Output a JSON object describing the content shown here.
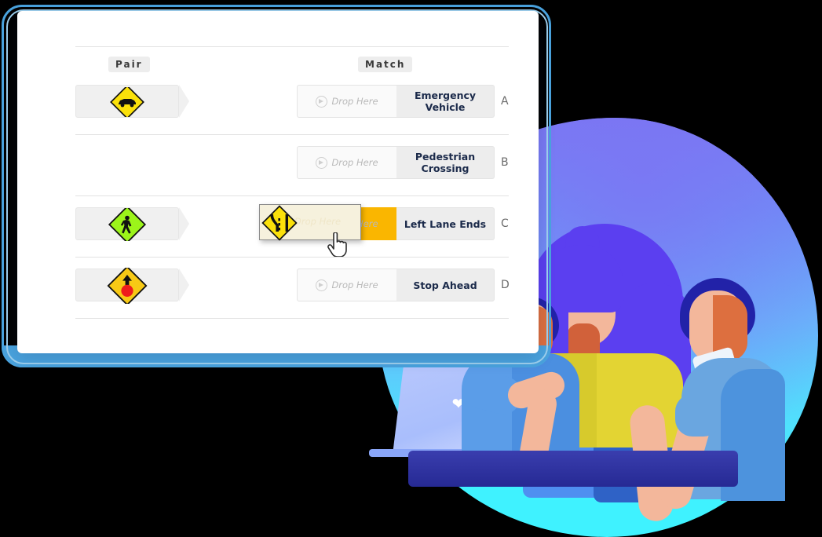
{
  "window": {
    "frame_color": "#4aa3de",
    "background": "#ffffff"
  },
  "quiz": {
    "column_headers": {
      "pair": "Pair",
      "match": "Match"
    },
    "drop_placeholder": "Drop Here",
    "drop_icon": "circle-arrow-right-icon",
    "rows": [
      {
        "letter": "A",
        "answer": "Emergency Vehicle",
        "pair_sign": "emergency-vehicle-sign",
        "pair_sign_alt": "yellow diamond with black vehicle",
        "has_pair": true,
        "drop_state": "empty"
      },
      {
        "letter": "B",
        "answer": "Pedestrian Crossing",
        "pair_sign": null,
        "pair_sign_alt": "",
        "has_pair": false,
        "drop_state": "empty"
      },
      {
        "letter": "C",
        "answer": "Left Lane Ends",
        "pair_sign": "pedestrian-crossing-sign",
        "pair_sign_alt": "green diamond with walking person",
        "has_pair": true,
        "drop_state": "highlighted"
      },
      {
        "letter": "D",
        "answer": "Stop Ahead",
        "pair_sign": "stop-ahead-sign",
        "pair_sign_alt": "yellow diamond with red octagon and arrow",
        "has_pair": true,
        "drop_state": "empty"
      }
    ],
    "dragging": {
      "sign": "left-lane-ends-sign",
      "sign_alt": "yellow diamond with merging lane lines",
      "label": "Drop Here",
      "target_row_letter": "C",
      "cursor": "pointing-hand-cursor"
    }
  },
  "illustration": {
    "name": "three-people-at-laptop-illustration",
    "blob_gradient_top": "#7b76f3",
    "blob_gradient_bottom": "#3ff2ff",
    "laptop_logo": "heart-icon",
    "desk_color": "#2b2fa8",
    "people": [
      {
        "name": "seated-person",
        "hair": "#2222a8",
        "shirt": "#4b8fe0"
      },
      {
        "name": "woman-with-purple-hair",
        "hair": "#5b3ff0",
        "top": "#e3d433",
        "skirt": "#4f8ff0"
      },
      {
        "name": "standing-man",
        "hair": "#2222a8",
        "shirt": "#6aa6e0"
      }
    ]
  },
  "colors": {
    "highlight": "#fab600",
    "card_bg": "#f0f0f0",
    "answer_text": "#1b2a4a",
    "placeholder_text": "#b9b9b9",
    "divider": "#e2e2e2"
  }
}
